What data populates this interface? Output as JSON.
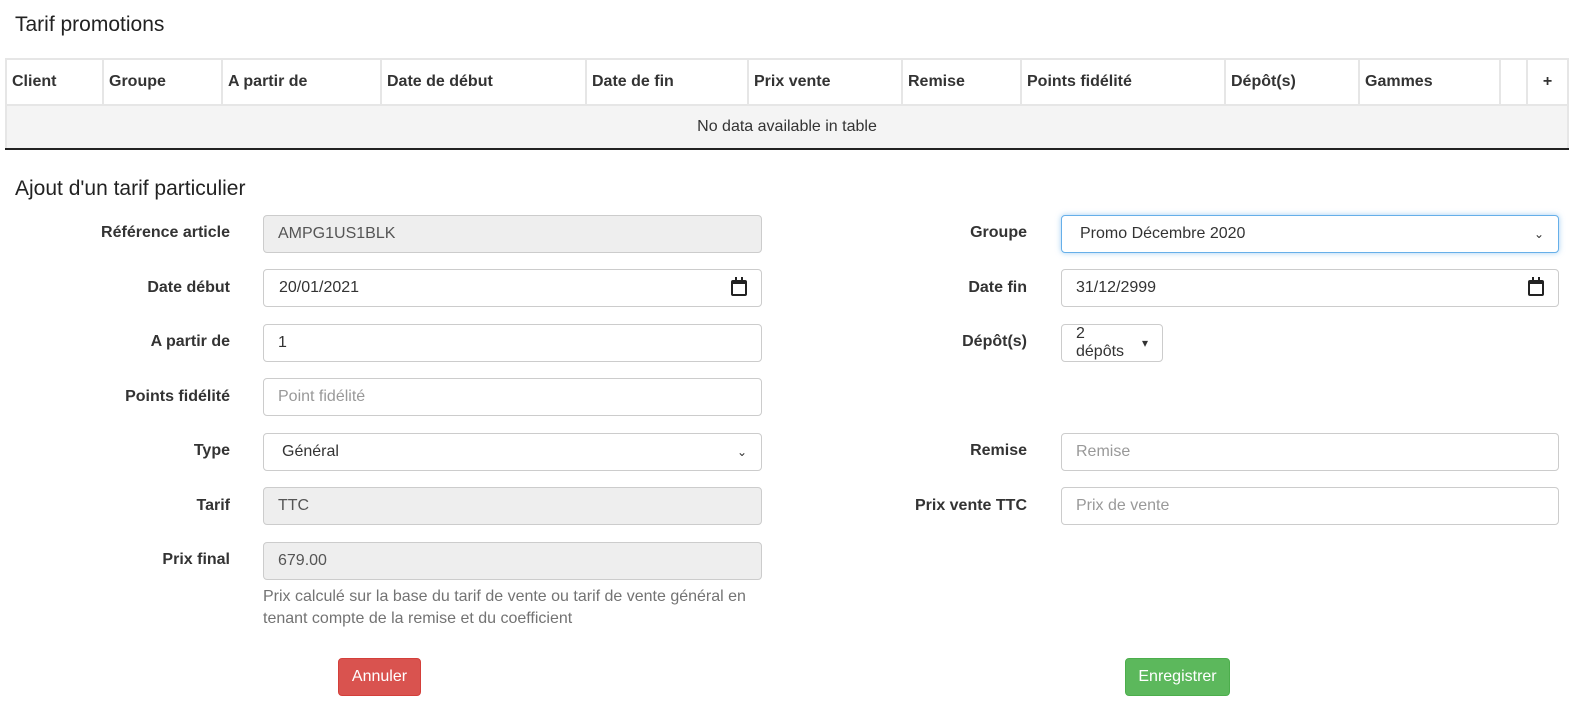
{
  "promotions": {
    "title": "Tarif promotions",
    "columns": [
      "Client",
      "Groupe",
      "A partir de",
      "Date de début",
      "Date de fin",
      "Prix vente",
      "Remise",
      "Points fidélité",
      "Dépôt(s)",
      "Gammes",
      "",
      "+"
    ],
    "empty_message": "No data available in table"
  },
  "form": {
    "title": "Ajout d'un tarif particulier",
    "reference": {
      "label": "Référence article",
      "value": "AMPG1US1BLK"
    },
    "date_debut": {
      "label": "Date début",
      "value": "20/01/2021"
    },
    "a_partir_de": {
      "label": "A partir de",
      "value": "1"
    },
    "points": {
      "label": "Points fidélité",
      "placeholder": "Point fidélité"
    },
    "type": {
      "label": "Type",
      "value": "Général"
    },
    "tarif": {
      "label": "Tarif",
      "value": "TTC"
    },
    "prix_final": {
      "label": "Prix final",
      "value": "679.00"
    },
    "help_text": "Prix calculé sur la base du tarif de vente ou tarif de vente général en tenant compte de la remise et du coefficient",
    "groupe": {
      "label": "Groupe",
      "value": "Promo Décembre 2020"
    },
    "date_fin": {
      "label": "Date fin",
      "value": "31/12/2999"
    },
    "depots": {
      "label": "Dépôt(s)",
      "value": "2 dépôts"
    },
    "remise": {
      "label": "Remise",
      "placeholder": "Remise"
    },
    "prix_vente": {
      "label": "Prix vente TTC",
      "placeholder": "Prix de vente"
    },
    "cancel_label": "Annuler",
    "save_label": "Enregistrer"
  },
  "colors": {
    "focus": "#66afe9",
    "danger": "#d9534f",
    "success": "#5cb85c"
  }
}
